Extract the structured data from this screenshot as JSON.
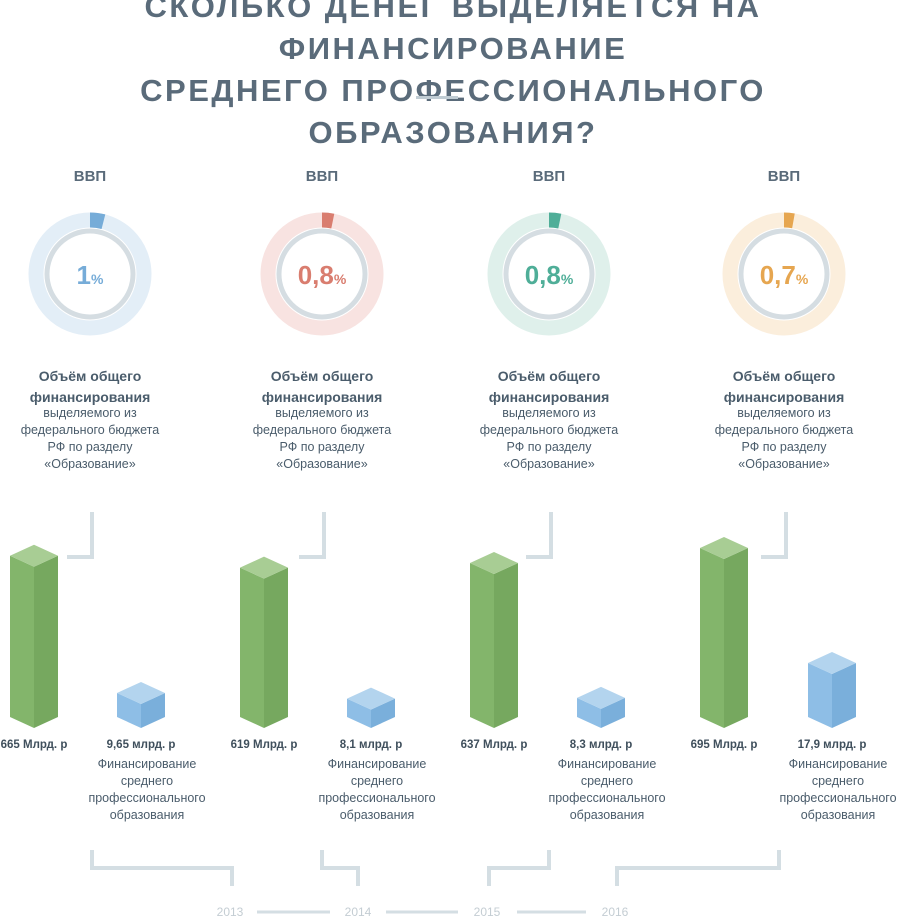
{
  "title": {
    "line1": "СКОЛЬКО ДЕНЕГ ВЫДЕЛЯЕТСЯ НА ФИНАНСИРОВАНИЕ",
    "line2": "СРЕДНЕГО ПРОФЕССИОНАЛЬНОГО ОБРАЗОВАНИЯ?"
  },
  "chart_data": {
    "type": "bar",
    "categories": [
      "2013",
      "2014",
      "2015",
      "2016"
    ],
    "gdp_share": [
      {
        "label": "ВВП",
        "value": 1,
        "display": "1",
        "unit": "%",
        "color": "#76acd8",
        "track": "#e3eef7"
      },
      {
        "label": "ВВП",
        "value": 0.8,
        "display": "0,8",
        "unit": "%",
        "color": "#d97d6f",
        "track": "#f8e3e1"
      },
      {
        "label": "ВВП",
        "value": 0.8,
        "display": "0,8",
        "unit": "%",
        "color": "#4fae98",
        "track": "#dff0eb"
      },
      {
        "label": "ВВП",
        "value": 0.7,
        "display": "0,7",
        "unit": "%",
        "color": "#e6a650",
        "track": "#fbeedc"
      }
    ],
    "description": {
      "bold_lines": [
        "Объём общего",
        "финансирования"
      ],
      "lines": [
        "выделяемого из",
        "федерального бюджета",
        "РФ по разделу",
        "«Образование»"
      ]
    },
    "series": [
      {
        "values": [
          665,
          619,
          637,
          695
        ],
        "labels": [
          "665 Млрд. р",
          "619 Млрд. р",
          "637 Млрд. р",
          "695 Млрд. р"
        ],
        "colors": {
          "top": "#a8cd94",
          "front": "#83b56b",
          "side": "#76a85f"
        }
      },
      {
        "values": [
          9.65,
          8.1,
          8.3,
          17.9
        ],
        "labels": [
          "9,65 млрд. р",
          "8,1 млрд. р",
          "8,3 млрд. р",
          "17,9 млрд. р"
        ],
        "caption": [
          "Финансирование",
          "среднего",
          "профессионального",
          "образования"
        ],
        "colors": {
          "top": "#b3d4ee",
          "front": "#8ebee6",
          "side": "#7aafdb"
        }
      }
    ],
    "years": [
      "2013",
      "2014",
      "2015",
      "2016"
    ]
  }
}
